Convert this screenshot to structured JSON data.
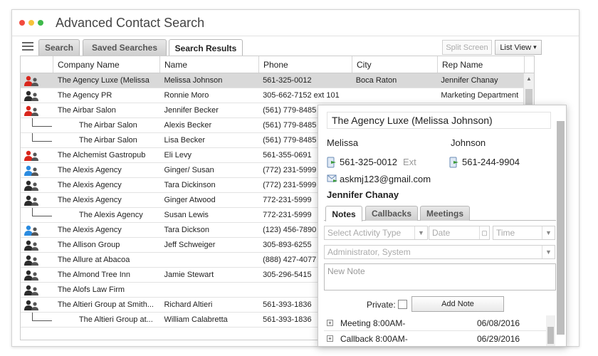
{
  "window": {
    "title": "Advanced Contact Search",
    "dot_colors": [
      "#f24b3f",
      "#f7c23b",
      "#3fb94a"
    ]
  },
  "toolbar": {
    "tabs": [
      "Search",
      "Saved Searches",
      "Search Results"
    ],
    "active_tab": "Search Results",
    "split_label": "Split Screen",
    "view_label": "List View",
    "view_arrow": "▾"
  },
  "grid": {
    "columns": [
      "Company Name",
      "Name",
      "Phone",
      "City",
      "Rep Name"
    ],
    "rows": [
      {
        "icon": "person-red-icon",
        "child": false,
        "company": "The Agency Luxe (Melissa Johnson)",
        "name": "Melissa Johnson",
        "phone": "561-325-0012",
        "city": "Boca Raton",
        "rep": "Jennifer Chanay"
      },
      {
        "icon": "person-dark-icon",
        "child": false,
        "company": "The Agency PR",
        "name": "Ronnie Moro",
        "phone": "305-662-7152 ext 101",
        "city": "",
        "rep": "Marketing Department"
      },
      {
        "icon": "person-red-icon",
        "child": false,
        "company": "The Airbar Salon",
        "name": "Jennifer Becker",
        "phone": "(561) 779-8485",
        "city": "",
        "rep": ""
      },
      {
        "icon": "",
        "child": true,
        "company": "The Airbar Salon",
        "name": "Alexis Becker",
        "phone": "(561) 779-8485",
        "city": "",
        "rep": ""
      },
      {
        "icon": "",
        "child": true,
        "company": "The Airbar Salon",
        "name": "Lisa Becker",
        "phone": "(561) 779-8485",
        "city": "",
        "rep": ""
      },
      {
        "icon": "person-red-icon",
        "child": false,
        "company": "The Alchemist Gastropub and Bar",
        "name": "Eli Levy",
        "phone": "561-355-0691",
        "city": "",
        "rep": ""
      },
      {
        "icon": "person-blue-icon",
        "child": false,
        "company": "The Alexis Agency",
        "name": "Ginger/ Susan",
        "phone": "(772) 231-5999",
        "city": "",
        "rep": ""
      },
      {
        "icon": "person-dark-icon",
        "child": false,
        "company": "The Alexis Agency",
        "name": "Tara Dickinson",
        "phone": "(772) 231-5999",
        "city": "",
        "rep": ""
      },
      {
        "icon": "person-dark-icon",
        "child": false,
        "company": "The Alexis Agency",
        "name": "Ginger Atwood",
        "phone": "772-231-5999",
        "city": "",
        "rep": ""
      },
      {
        "icon": "",
        "child": true,
        "company": "The Alexis Agency",
        "name": "Susan Lewis",
        "phone": "772-231-5999",
        "city": "",
        "rep": ""
      },
      {
        "icon": "person-blue-icon",
        "child": false,
        "company": "The Alexis Agency",
        "name": "Tara Dickson",
        "phone": "(123) 456-7890",
        "city": "",
        "rep": ""
      },
      {
        "icon": "person-dark-icon",
        "child": false,
        "company": "The Allison Group",
        "name": "Jeff Schweiger",
        "phone": "305-893-6255",
        "city": "",
        "rep": ""
      },
      {
        "icon": "person-dark-icon",
        "child": false,
        "company": "The Allure at Abacoa",
        "name": "",
        "phone": "(888) 427-4077",
        "city": "",
        "rep": ""
      },
      {
        "icon": "person-dark-icon",
        "child": false,
        "company": "The Almond Tree Inn",
        "name": "Jamie Stewart",
        "phone": "305-296-5415",
        "city": "",
        "rep": ""
      },
      {
        "icon": "person-dark-icon",
        "child": false,
        "company": "The Alofs Law Firm",
        "name": "",
        "phone": "",
        "city": "",
        "rep": ""
      },
      {
        "icon": "person-dark-icon",
        "child": false,
        "company": "The Altieri Group at Smith Barney",
        "name": "Richard Altieri",
        "phone": "561-393-1836",
        "city": "",
        "rep": ""
      },
      {
        "icon": "",
        "child": true,
        "company": "The Altieri Group at Smith Barney",
        "name": "William Calabretta",
        "phone": "561-393-1836",
        "city": "",
        "rep": ""
      }
    ],
    "row_display": [
      "The Agency Luxe (Melissa",
      "The Agency PR",
      "The Airbar Salon",
      "The Airbar Salon",
      "The Airbar Salon",
      "The Alchemist Gastropub",
      "The Alexis Agency",
      "The Alexis Agency",
      "The Alexis Agency",
      "The Alexis Agency",
      "The Alexis Agency",
      "The Allison Group",
      "The Allure at Abacoa",
      "The Almond Tree Inn",
      "The Alofs Law Firm",
      "The Altieri Group at Smith...",
      "The Altieri Group at..."
    ]
  },
  "popup": {
    "title": "The Agency Luxe (Melissa Johnson)",
    "first_name": "Melissa",
    "last_name": "Johnson",
    "phone1": "561-325-0012",
    "ext_label": "Ext",
    "phone2": "561-244-9904",
    "email": "askmj123@gmail.com",
    "rep": "Jennifer Chanay",
    "tabs": [
      "Notes",
      "Callbacks",
      "Meetings"
    ],
    "active_tab": "Notes",
    "activity_placeholder": "Select Activity Type",
    "date_placeholder": "Date",
    "time_placeholder": "Time",
    "user_value": "Administrator, System",
    "note_placeholder": "New Note",
    "private_label": "Private:",
    "add_note_label": "Add Note",
    "activities": [
      {
        "label": "Meeting 8:00AM-",
        "date": "06/08/2016"
      },
      {
        "label": "Callback 8:00AM-",
        "date": "06/29/2016"
      }
    ]
  },
  "colors": {
    "red_person": "#d9261c",
    "blue_person": "#2a8be0",
    "dark_person": "#2b2b2b",
    "phone_green": "#3b9a3b"
  }
}
